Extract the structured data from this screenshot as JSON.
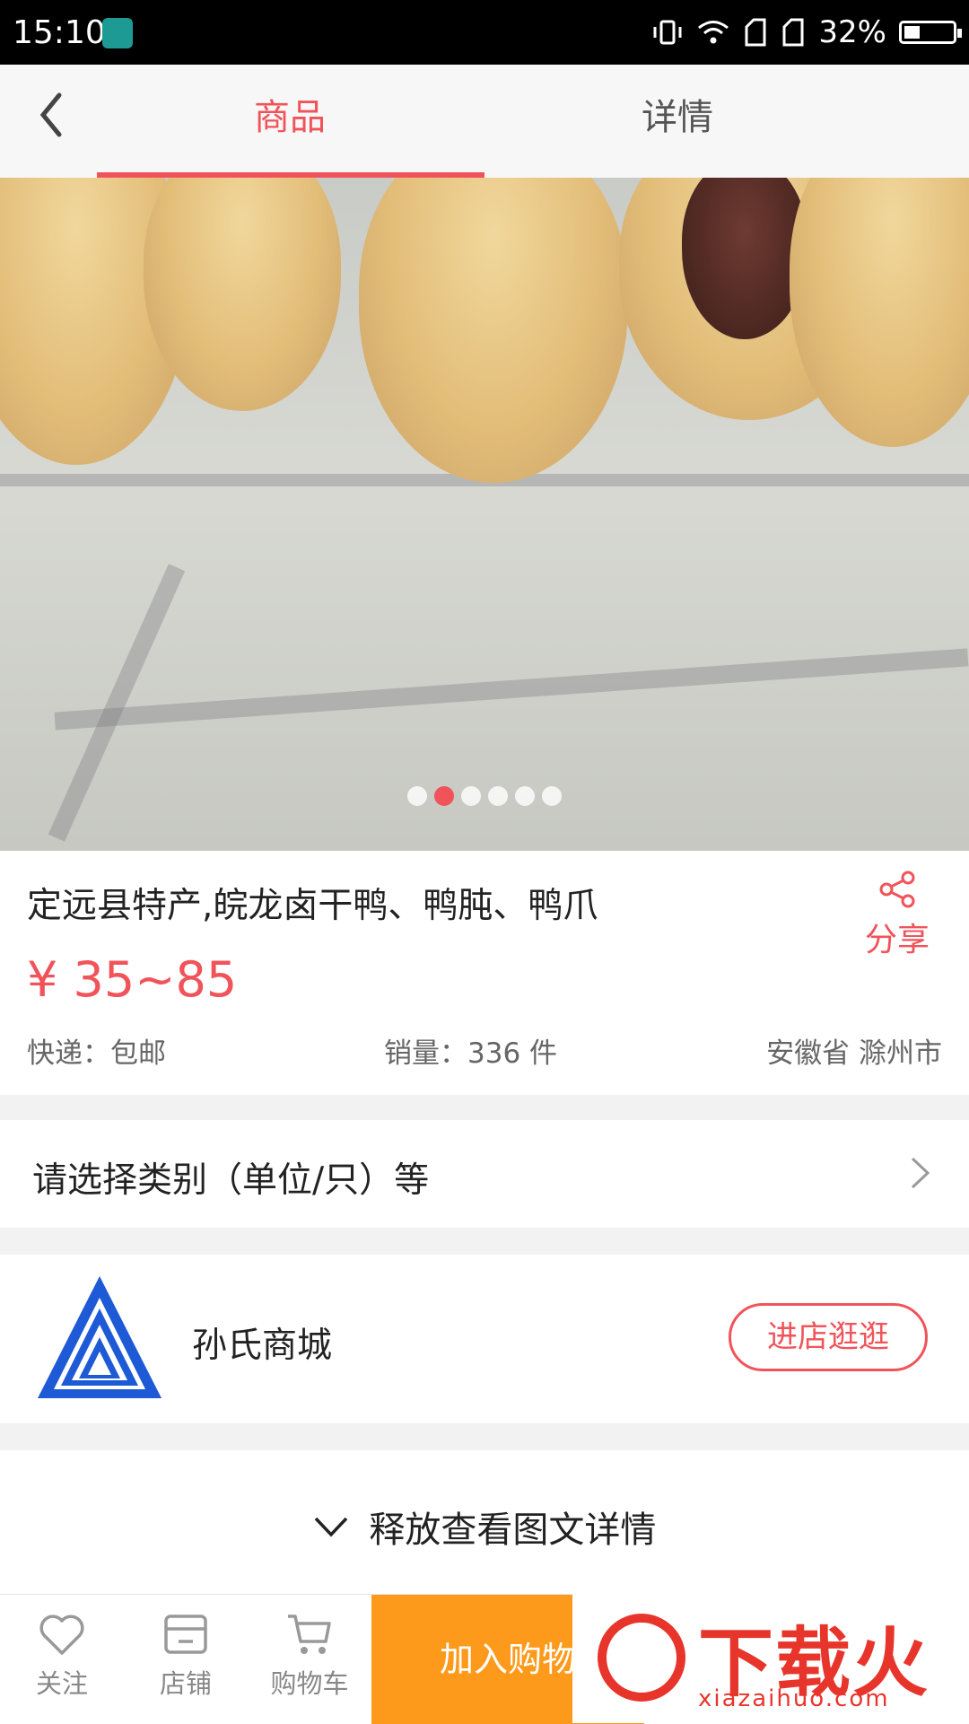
{
  "status_bar": {
    "time": "15:10",
    "battery": "32%",
    "battery_level": 0.32
  },
  "nav": {
    "tabs": [
      {
        "label": "商品",
        "active": true
      },
      {
        "label": "详情",
        "active": false
      }
    ]
  },
  "gallery": {
    "image_count": 6,
    "active_index": 1
  },
  "product": {
    "title": "定远县特产,皖龙卤干鸭、鸭肫、鸭爪",
    "price": "¥ 35~85",
    "shipping": "快递：包邮",
    "sales": "销量：336 件",
    "location": "安徽省 滁州市",
    "share_label": "分享"
  },
  "options": {
    "label": "请选择类别（单位/只）等"
  },
  "shop": {
    "name": "孙氏商城",
    "visit_label": "进店逛逛"
  },
  "details_hint": {
    "label": "释放查看图文详情"
  },
  "bottom_bar": {
    "follow": "关注",
    "store": "店铺",
    "cart": "购物车",
    "add_to_cart": "加入购物车"
  },
  "watermark": {
    "text": "下载火",
    "url": "xiazaihuo.com"
  },
  "colors": {
    "accent": "#f0545a",
    "cart_button": "#fe9a1b",
    "watermark": "#e8352c",
    "shop_logo": "#1e5ad6"
  }
}
